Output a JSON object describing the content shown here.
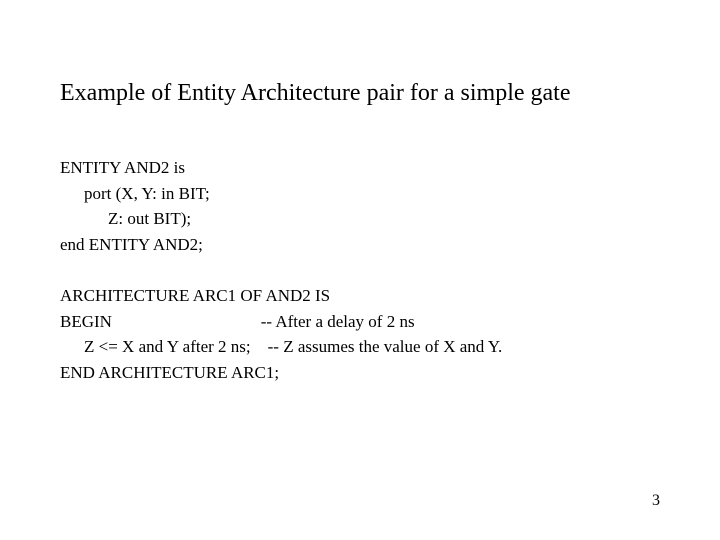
{
  "title": "Example of Entity Architecture pair for a simple gate",
  "entity": {
    "line1": "ENTITY AND2 is",
    "line2": "port (X, Y: in BIT;",
    "line3": "Z: out BIT);",
    "line4": "end ENTITY AND2;"
  },
  "architecture": {
    "line1": "ARCHITECTURE ARC1 OF AND2 IS",
    "line2": "BEGIN                                   -- After a delay of 2 ns",
    "line3": "Z <= X and Y after 2 ns;    -- Z assumes the value of X and Y.",
    "line4": "END ARCHITECTURE ARC1;"
  },
  "pageNumber": "3"
}
